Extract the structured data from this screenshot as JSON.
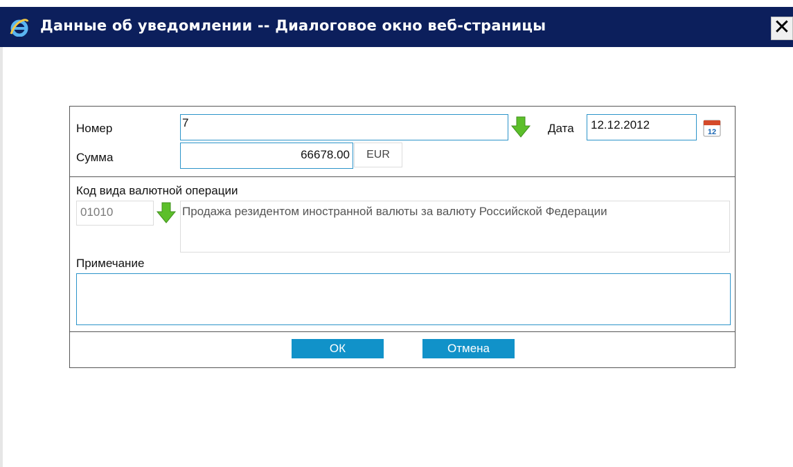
{
  "window": {
    "title": "Данные об уведомлении -- Диалоговое окно веб-страницы",
    "close_glyph": "✕"
  },
  "form": {
    "number": {
      "label": "Номер",
      "value": "7"
    },
    "date": {
      "label": "Дата",
      "value": "12.12.2012"
    },
    "amount": {
      "label": "Сумма",
      "value": "66678.00",
      "currency": "EUR"
    },
    "operation": {
      "label": "Код вида валютной операции",
      "code": "01010",
      "description": "Продажа резидентом иностранной валюты за валюту Российской Федерации"
    },
    "note": {
      "label": "Примечание",
      "value": ""
    },
    "calendar_icon_day": "12"
  },
  "buttons": {
    "ok": "ОК",
    "cancel": "Отмена"
  },
  "colors": {
    "titlebar": "#0c1f5c",
    "field_border": "#2b93c9",
    "button": "#1192c9",
    "arrow": "#5cbf2a"
  },
  "icons": [
    "ie-icon",
    "close-icon",
    "select-arrow-icon",
    "calendar-icon"
  ]
}
